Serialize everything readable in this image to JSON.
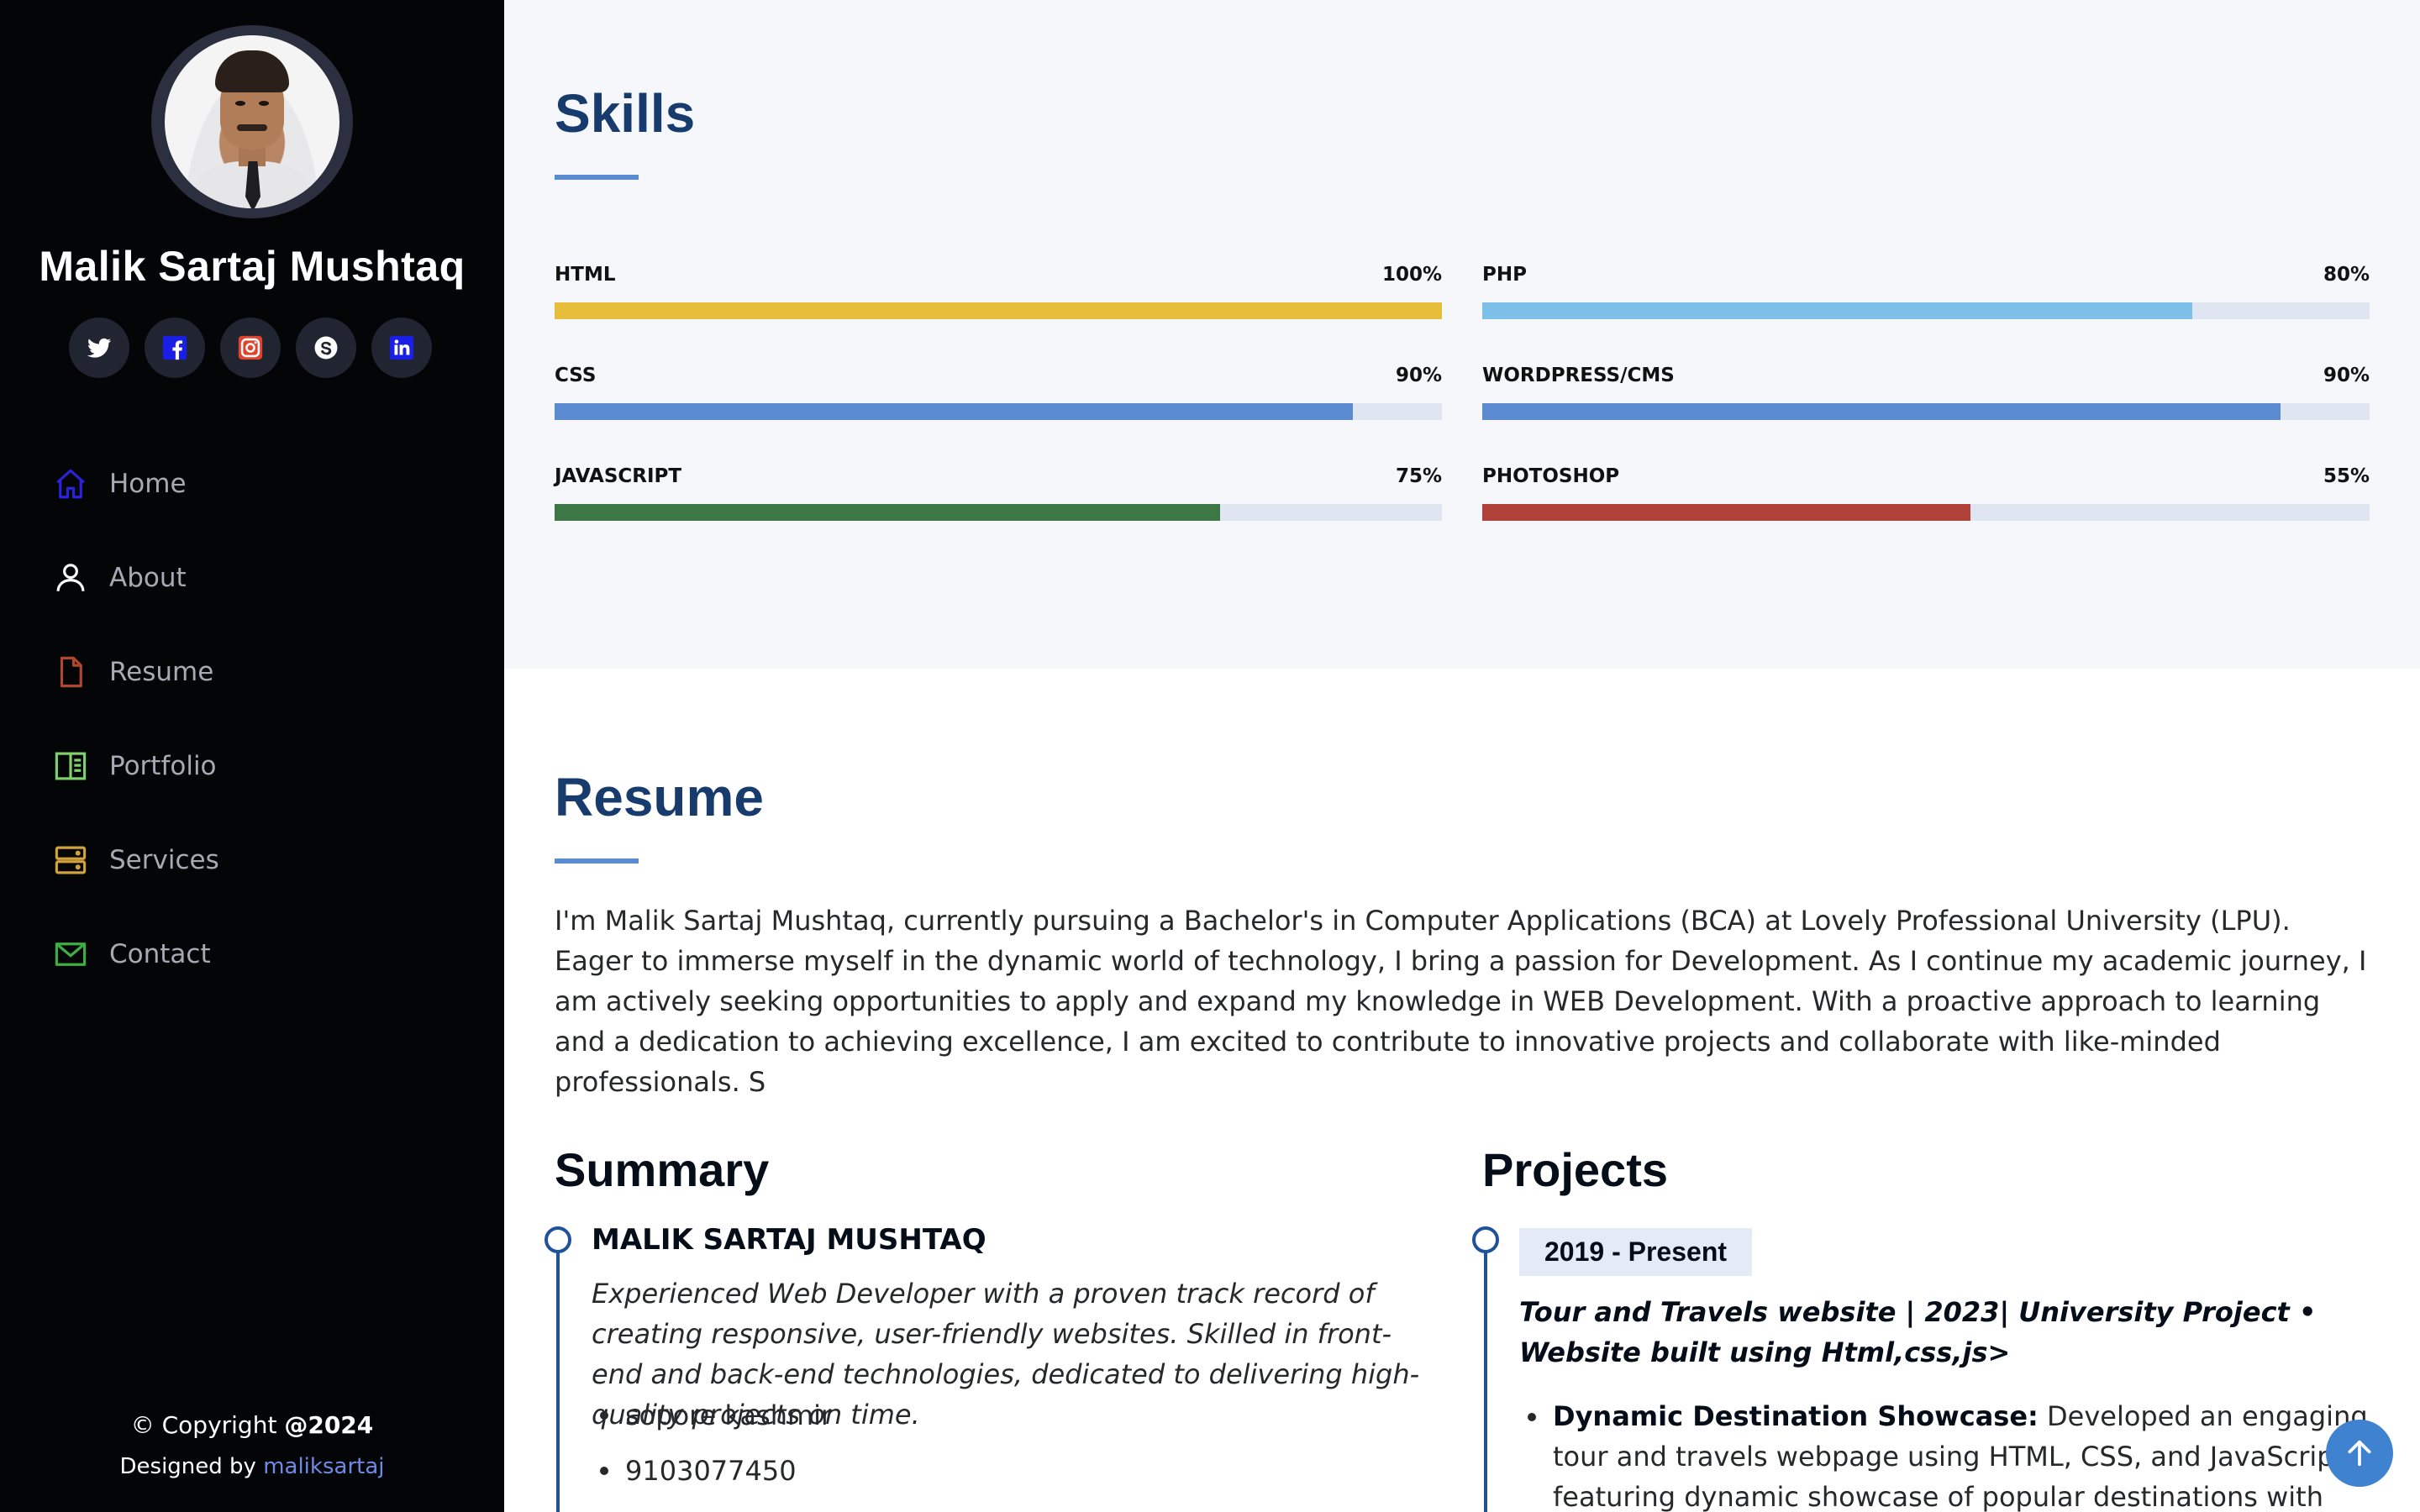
{
  "profile": {
    "name": "Malik Sartaj Mushtaq"
  },
  "socials": [
    {
      "name": "twitter-icon",
      "color": "#ffffff"
    },
    {
      "name": "facebook-icon",
      "color": "#1a1fe6"
    },
    {
      "name": "instagram-icon",
      "color": "#e0422e"
    },
    {
      "name": "skype-icon",
      "color": "#ffffff"
    },
    {
      "name": "linkedin-icon",
      "color": "#1a1fe6"
    }
  ],
  "nav": {
    "items": [
      {
        "label": "Home",
        "icon": "house-icon",
        "color": "#2b22e0"
      },
      {
        "label": "About",
        "icon": "person-icon",
        "color": "#ffffff"
      },
      {
        "label": "Resume",
        "icon": "file-icon",
        "color": "#b1462f"
      },
      {
        "label": "Portfolio",
        "icon": "book-half-icon",
        "color": "#7fd36f"
      },
      {
        "label": "Services",
        "icon": "server-icon",
        "color": "#d2a23a"
      },
      {
        "label": "Contact",
        "icon": "envelope-icon",
        "color": "#3fae43"
      }
    ]
  },
  "footer": {
    "copyright_prefix": "© Copyright ",
    "copyright_year": "@2024",
    "credit_prefix": "Designed by ",
    "credit_link": "maliksartaj"
  },
  "skills": {
    "title": "Skills",
    "items": [
      {
        "label": "HTML",
        "percent_label": "100%",
        "value": 100,
        "color": "#e5bd3a"
      },
      {
        "label": "PHP",
        "percent_label": "80%",
        "value": 80,
        "color": "#7cbfe8"
      },
      {
        "label": "CSS",
        "percent_label": "90%",
        "value": 90,
        "color": "#5b8bd1"
      },
      {
        "label": "WORDPRESS/CMS",
        "percent_label": "90%",
        "value": 90,
        "color": "#5b8bd1"
      },
      {
        "label": "JAVASCRIPT",
        "percent_label": "75%",
        "value": 75,
        "color": "#3e7746"
      },
      {
        "label": "PHOTOSHOP",
        "percent_label": "55%",
        "value": 55,
        "color": "#b0423a"
      }
    ]
  },
  "resume": {
    "title": "Resume",
    "intro": "I'm Malik Sartaj Mushtaq, currently pursuing a Bachelor's in Computer Applications (BCA) at Lovely Professional University (LPU). Eager to immerse myself in the dynamic world of technology, I bring a passion for Development. As I continue my academic journey, I am actively seeking opportunities to apply and expand my knowledge in WEB Development. With a proactive approach to learning and a dedication to achieving excellence, I am excited to contribute to innovative projects and collaborate with like-minded professionals. S",
    "summary": {
      "title": "Summary",
      "name": "MALIK SARTAJ MUSHTAQ",
      "text": "Experienced Web Developer with a proven track record of creating responsive, user-friendly websites. Skilled in front-end and back-end technologies, dedicated to delivering high-quality projects on time.",
      "items": [
        "sopore kashmir",
        "9103077450"
      ]
    },
    "projects": {
      "title": "Projects",
      "date": "2019 - Present",
      "project_title": "Tour and Travels website | 2023| University Project • Website built using Html,css,js>",
      "items": [
        {
          "bold": "Dynamic Destination Showcase:",
          "text": " Developed an engaging tour and travels webpage using HTML, CSS, and JavaScript, featuring dynamic showcase of popular destinations with attractive images"
        }
      ]
    }
  }
}
